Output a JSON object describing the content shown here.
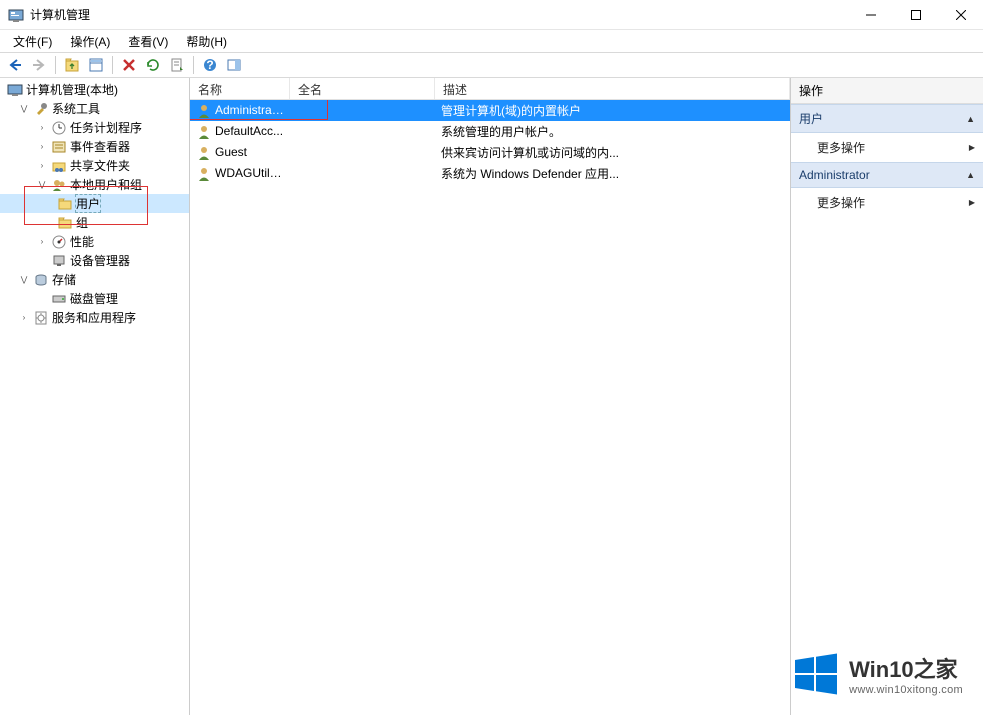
{
  "window": {
    "title": "计算机管理"
  },
  "menu": {
    "file": "文件(F)",
    "action": "操作(A)",
    "view": "查看(V)",
    "help": "帮助(H)"
  },
  "tree": {
    "root": "计算机管理(本地)",
    "system_tools": "系统工具",
    "task_scheduler": "任务计划程序",
    "event_viewer": "事件查看器",
    "shared_folders": "共享文件夹",
    "local_users_groups": "本地用户和组",
    "users": "用户",
    "groups": "组",
    "performance": "性能",
    "device_manager": "设备管理器",
    "storage": "存储",
    "disk_management": "磁盘管理",
    "services_apps": "服务和应用程序"
  },
  "columns": {
    "name": "名称",
    "fullname": "全名",
    "description": "描述"
  },
  "users_list": [
    {
      "name": "Administrat...",
      "fullname": "",
      "description": "管理计算机(域)的内置帐户",
      "selected": true
    },
    {
      "name": "DefaultAcc...",
      "fullname": "",
      "description": "系统管理的用户帐户。",
      "selected": false
    },
    {
      "name": "Guest",
      "fullname": "",
      "description": "供来宾访问计算机或访问域的内...",
      "selected": false
    },
    {
      "name": "WDAGUtilit...",
      "fullname": "",
      "description": "系统为 Windows Defender 应用...",
      "selected": false
    }
  ],
  "actions": {
    "title": "操作",
    "section_user": "用户",
    "section_admin": "Administrator",
    "more_actions": "更多操作"
  },
  "watermark": {
    "big": "Win10之家",
    "small": "www.win10xitong.com"
  }
}
